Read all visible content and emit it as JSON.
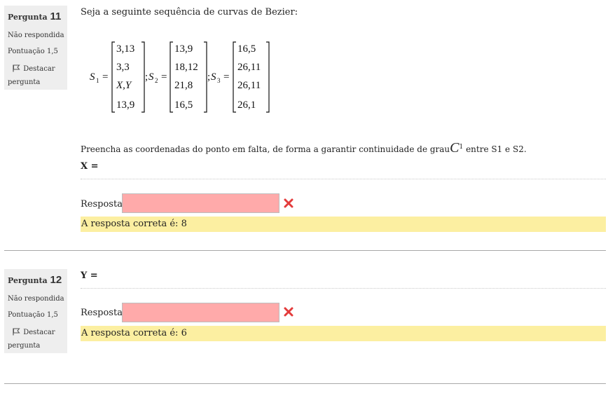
{
  "questions": [
    {
      "number_prefix": "Pergunta",
      "number": "11",
      "status": "Não respondida",
      "score": "Pontuação 1,5",
      "flag_label": "Destacar pergunta",
      "intro": "Seja a seguinte sequência de curvas de Bezier:",
      "matrices": {
        "S1": [
          "3,13",
          "3,3",
          "X,Y",
          "13,9"
        ],
        "S2": [
          "13,9",
          "18,12",
          "21,8",
          "16,5"
        ],
        "S3": [
          "16,5",
          "26,11",
          "26,11",
          "26,1"
        ]
      },
      "prompt_before": "Preencha as coordenadas do ponto em falta, de forma a garantir continuidade de grau",
      "prompt_math": "C",
      "prompt_sup": "1",
      "prompt_after": "entre S1 e S2.",
      "var_label": "X =",
      "answer_label": "Resposta:",
      "answer_value": "",
      "correct_text": "A resposta correta é: 8"
    },
    {
      "number_prefix": "Pergunta",
      "number": "12",
      "status": "Não respondida",
      "score": "Pontuação 1,5",
      "flag_label": "Destacar pergunta",
      "var_label": "Y =",
      "answer_label": "Resposta:",
      "answer_value": "",
      "correct_text": "A resposta correta é: 6"
    }
  ],
  "colors": {
    "info_bg": "#eeeeee",
    "incorrect_input_bg": "#ffaaaa",
    "feedback_bg": "#fcefa1",
    "incorrect_icon": "#e33b3b"
  },
  "icons": {
    "flag": "flag-icon",
    "incorrect": "cross-icon"
  }
}
